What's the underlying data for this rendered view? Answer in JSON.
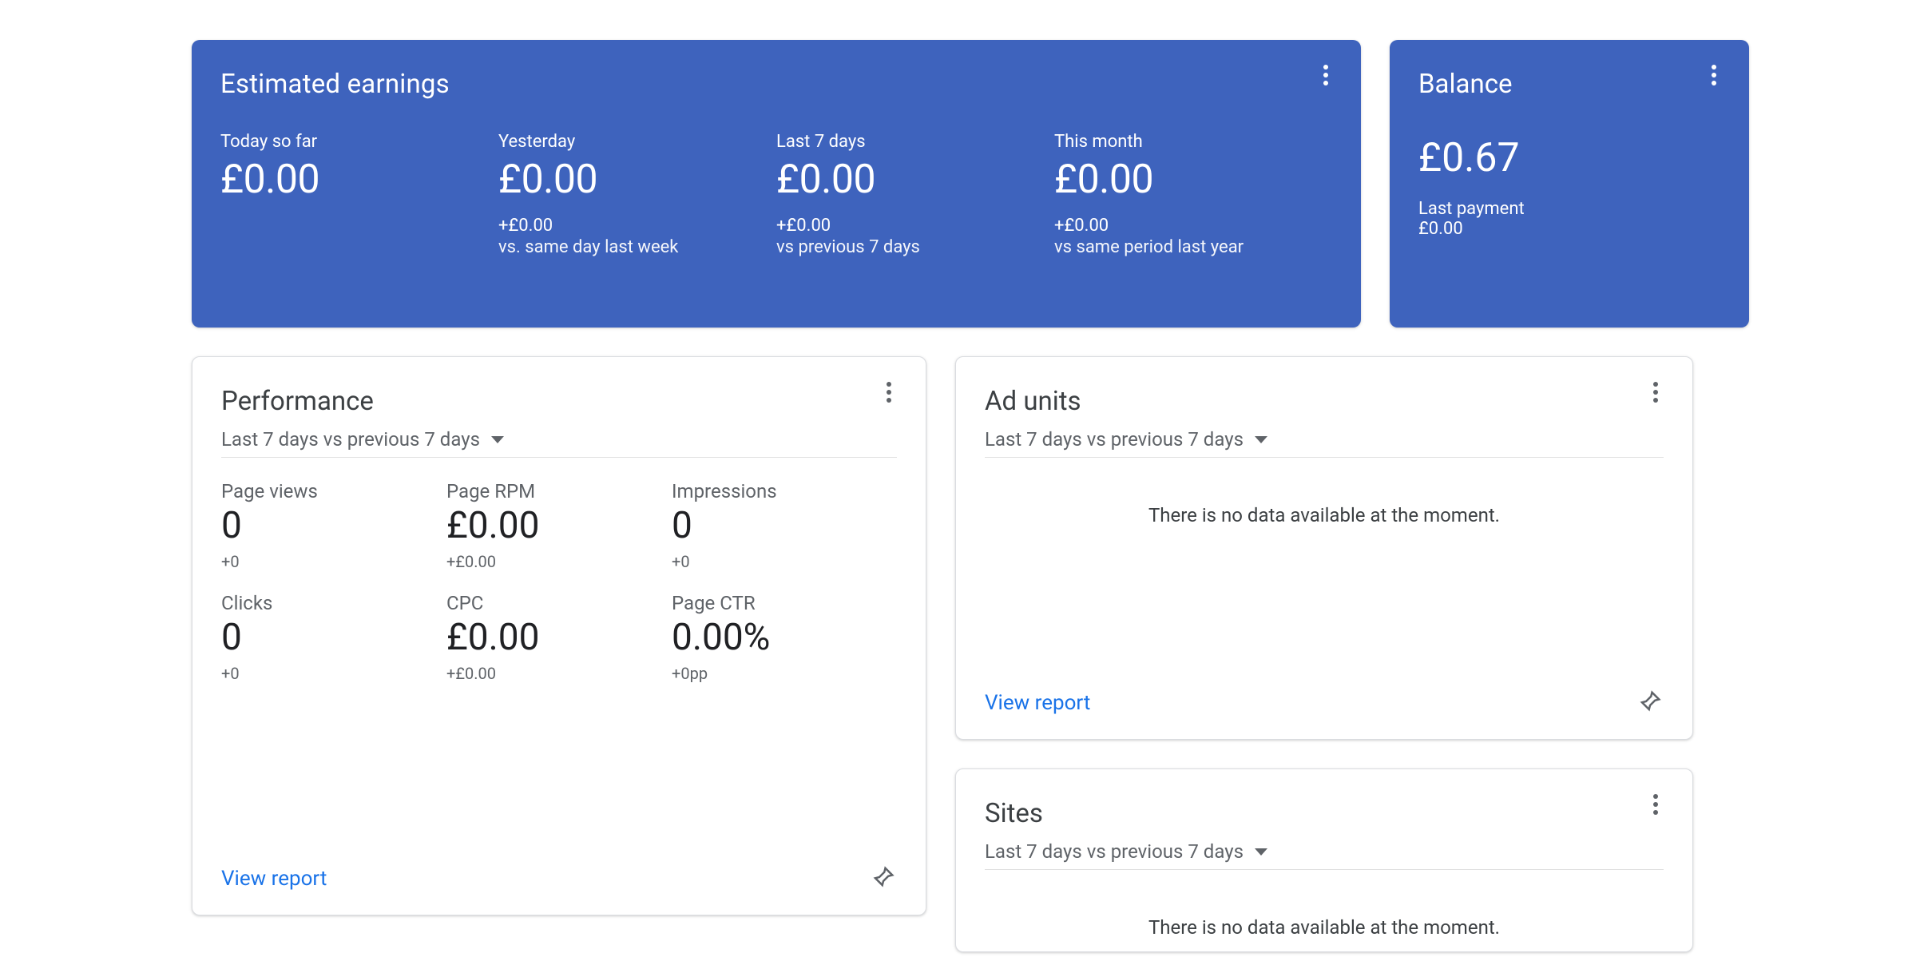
{
  "earnings": {
    "title": "Estimated earnings",
    "cols": [
      {
        "label": "Today so far",
        "value": "£0.00",
        "delta": "",
        "compare": ""
      },
      {
        "label": "Yesterday",
        "value": "£0.00",
        "delta": "+£0.00",
        "compare": "vs. same day last week"
      },
      {
        "label": "Last 7 days",
        "value": "£0.00",
        "delta": "+£0.00",
        "compare": "vs previous 7 days"
      },
      {
        "label": "This month",
        "value": "£0.00",
        "delta": "+£0.00",
        "compare": "vs same period last year"
      }
    ]
  },
  "balance": {
    "title": "Balance",
    "value": "£0.67",
    "last_payment_label": "Last payment",
    "last_payment_value": "£0.00"
  },
  "performance": {
    "title": "Performance",
    "range": "Last 7 days vs previous 7 days",
    "metrics": [
      {
        "label": "Page views",
        "value": "0",
        "delta": "+0"
      },
      {
        "label": "Page RPM",
        "value": "£0.00",
        "delta": "+£0.00"
      },
      {
        "label": "Impressions",
        "value": "0",
        "delta": "+0"
      },
      {
        "label": "Clicks",
        "value": "0",
        "delta": "+0"
      },
      {
        "label": "CPC",
        "value": "£0.00",
        "delta": "+£0.00"
      },
      {
        "label": "Page CTR",
        "value": "0.00%",
        "delta": "+0pp"
      }
    ],
    "view_report": "View report"
  },
  "adunits": {
    "title": "Ad units",
    "range": "Last 7 days vs previous 7 days",
    "empty": "There is no data available at the moment.",
    "view_report": "View report"
  },
  "sites": {
    "title": "Sites",
    "range": "Last 7 days vs previous 7 days",
    "empty": "There is no data available at the moment."
  }
}
